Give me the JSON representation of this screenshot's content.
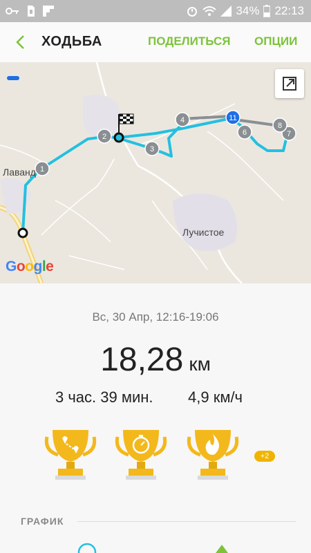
{
  "status_bar": {
    "battery": "34%",
    "time": "22:13"
  },
  "header": {
    "title": "ХОДЬБА",
    "share_label": "ПОДЕЛИТЬСЯ",
    "options_label": "ОПЦИИ"
  },
  "map": {
    "labels": {
      "town_left": "Лаванд",
      "town_right": "Лучистое"
    },
    "markers": [
      "1",
      "2",
      "3",
      "4",
      "11",
      "6",
      "7",
      "8"
    ],
    "logo_text": "Google"
  },
  "workout": {
    "date": "Вс, 30 Апр, 12:16-19:06",
    "distance_value": "18,28",
    "distance_unit": "км",
    "duration": "3 час. 39 мин.",
    "speed": "4,9 км/ч"
  },
  "achievements": {
    "extra_count": "+2"
  },
  "sections": {
    "chart_title": "ГРАФИК"
  },
  "colors": {
    "accent": "#7cc33a",
    "route": "#23c0e0",
    "trophy": "#f3b81c"
  }
}
